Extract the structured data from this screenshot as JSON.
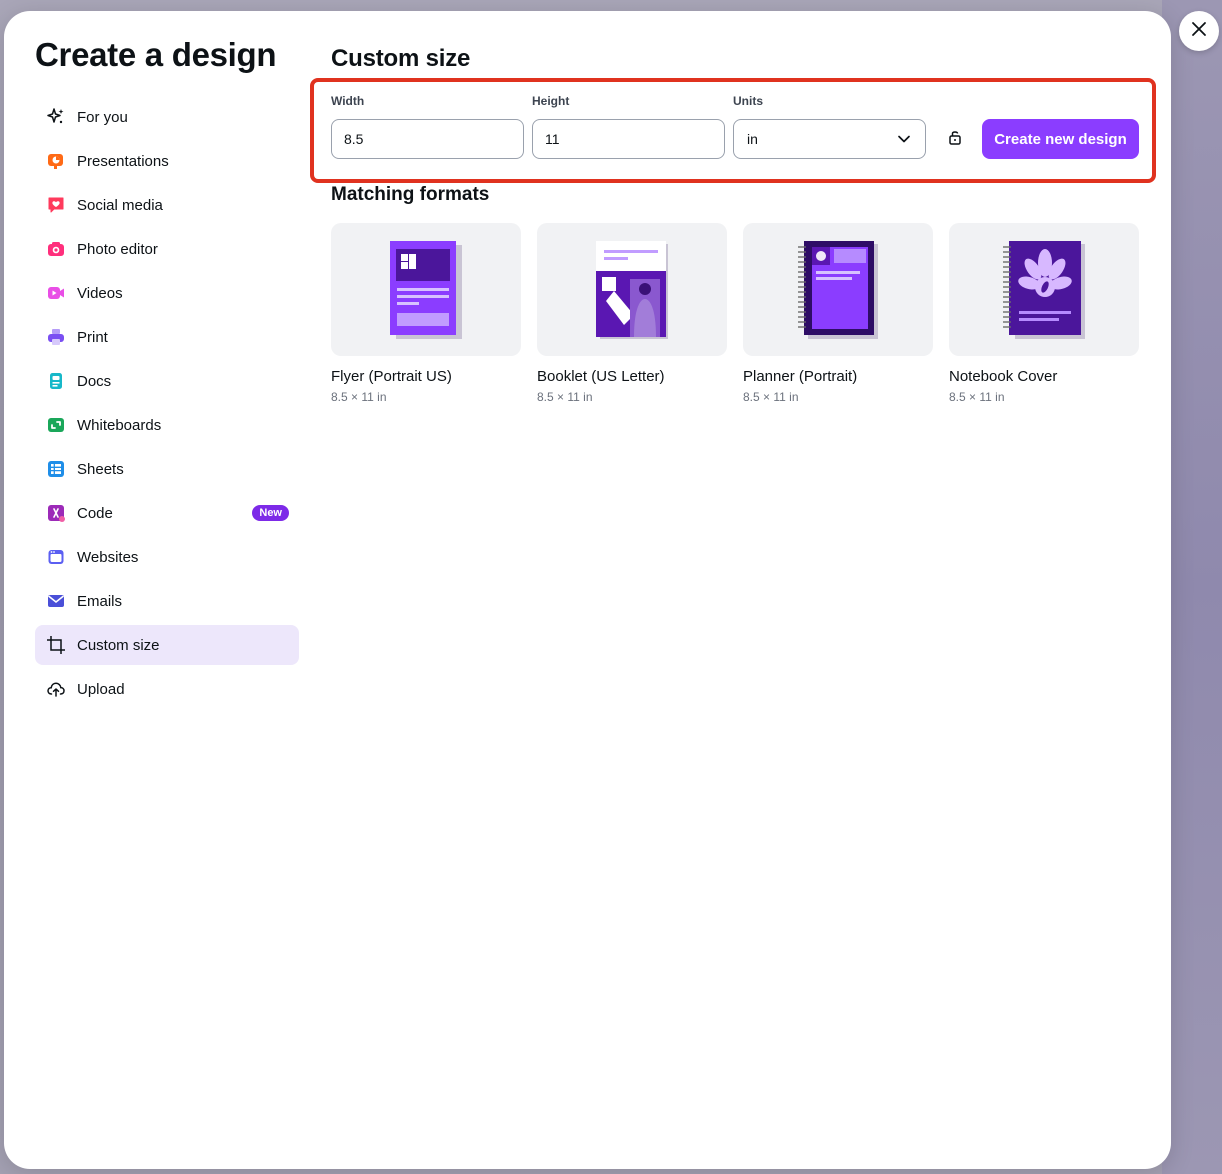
{
  "modal": {
    "title": "Create a design"
  },
  "sidebar": {
    "items": [
      {
        "label": "For you",
        "icon": "sparkles-icon"
      },
      {
        "label": "Presentations",
        "icon": "presentation-icon"
      },
      {
        "label": "Social media",
        "icon": "heart-bubble-icon"
      },
      {
        "label": "Photo editor",
        "icon": "camera-icon"
      },
      {
        "label": "Videos",
        "icon": "video-icon"
      },
      {
        "label": "Print",
        "icon": "printer-icon"
      },
      {
        "label": "Docs",
        "icon": "doc-icon"
      },
      {
        "label": "Whiteboards",
        "icon": "whiteboard-icon"
      },
      {
        "label": "Sheets",
        "icon": "sheet-icon"
      },
      {
        "label": "Code",
        "icon": "code-icon",
        "badge": "New"
      },
      {
        "label": "Websites",
        "icon": "website-icon"
      },
      {
        "label": "Emails",
        "icon": "email-icon"
      },
      {
        "label": "Custom size",
        "icon": "custom-size-icon",
        "active": true
      },
      {
        "label": "Upload",
        "icon": "cloud-upload-icon"
      }
    ]
  },
  "custom_size": {
    "title": "Custom size",
    "width_label": "Width",
    "width_value": "8.5",
    "height_label": "Height",
    "height_value": "11",
    "units_label": "Units",
    "units_value": "in",
    "lock_icon": "lock-icon",
    "create_button": "Create new design"
  },
  "matching": {
    "title": "Matching formats",
    "formats": [
      {
        "name": "Flyer (Portrait US)",
        "size": "8.5 × 11 in"
      },
      {
        "name": "Booklet (US Letter)",
        "size": "8.5 × 11 in"
      },
      {
        "name": "Planner (Portrait)",
        "size": "8.5 × 11 in"
      },
      {
        "name": "Notebook Cover",
        "size": "8.5 × 11 in"
      }
    ]
  },
  "colors": {
    "accent": "#8b3dff",
    "active_bg": "#ede7fb",
    "highlight": "#e0321f"
  }
}
